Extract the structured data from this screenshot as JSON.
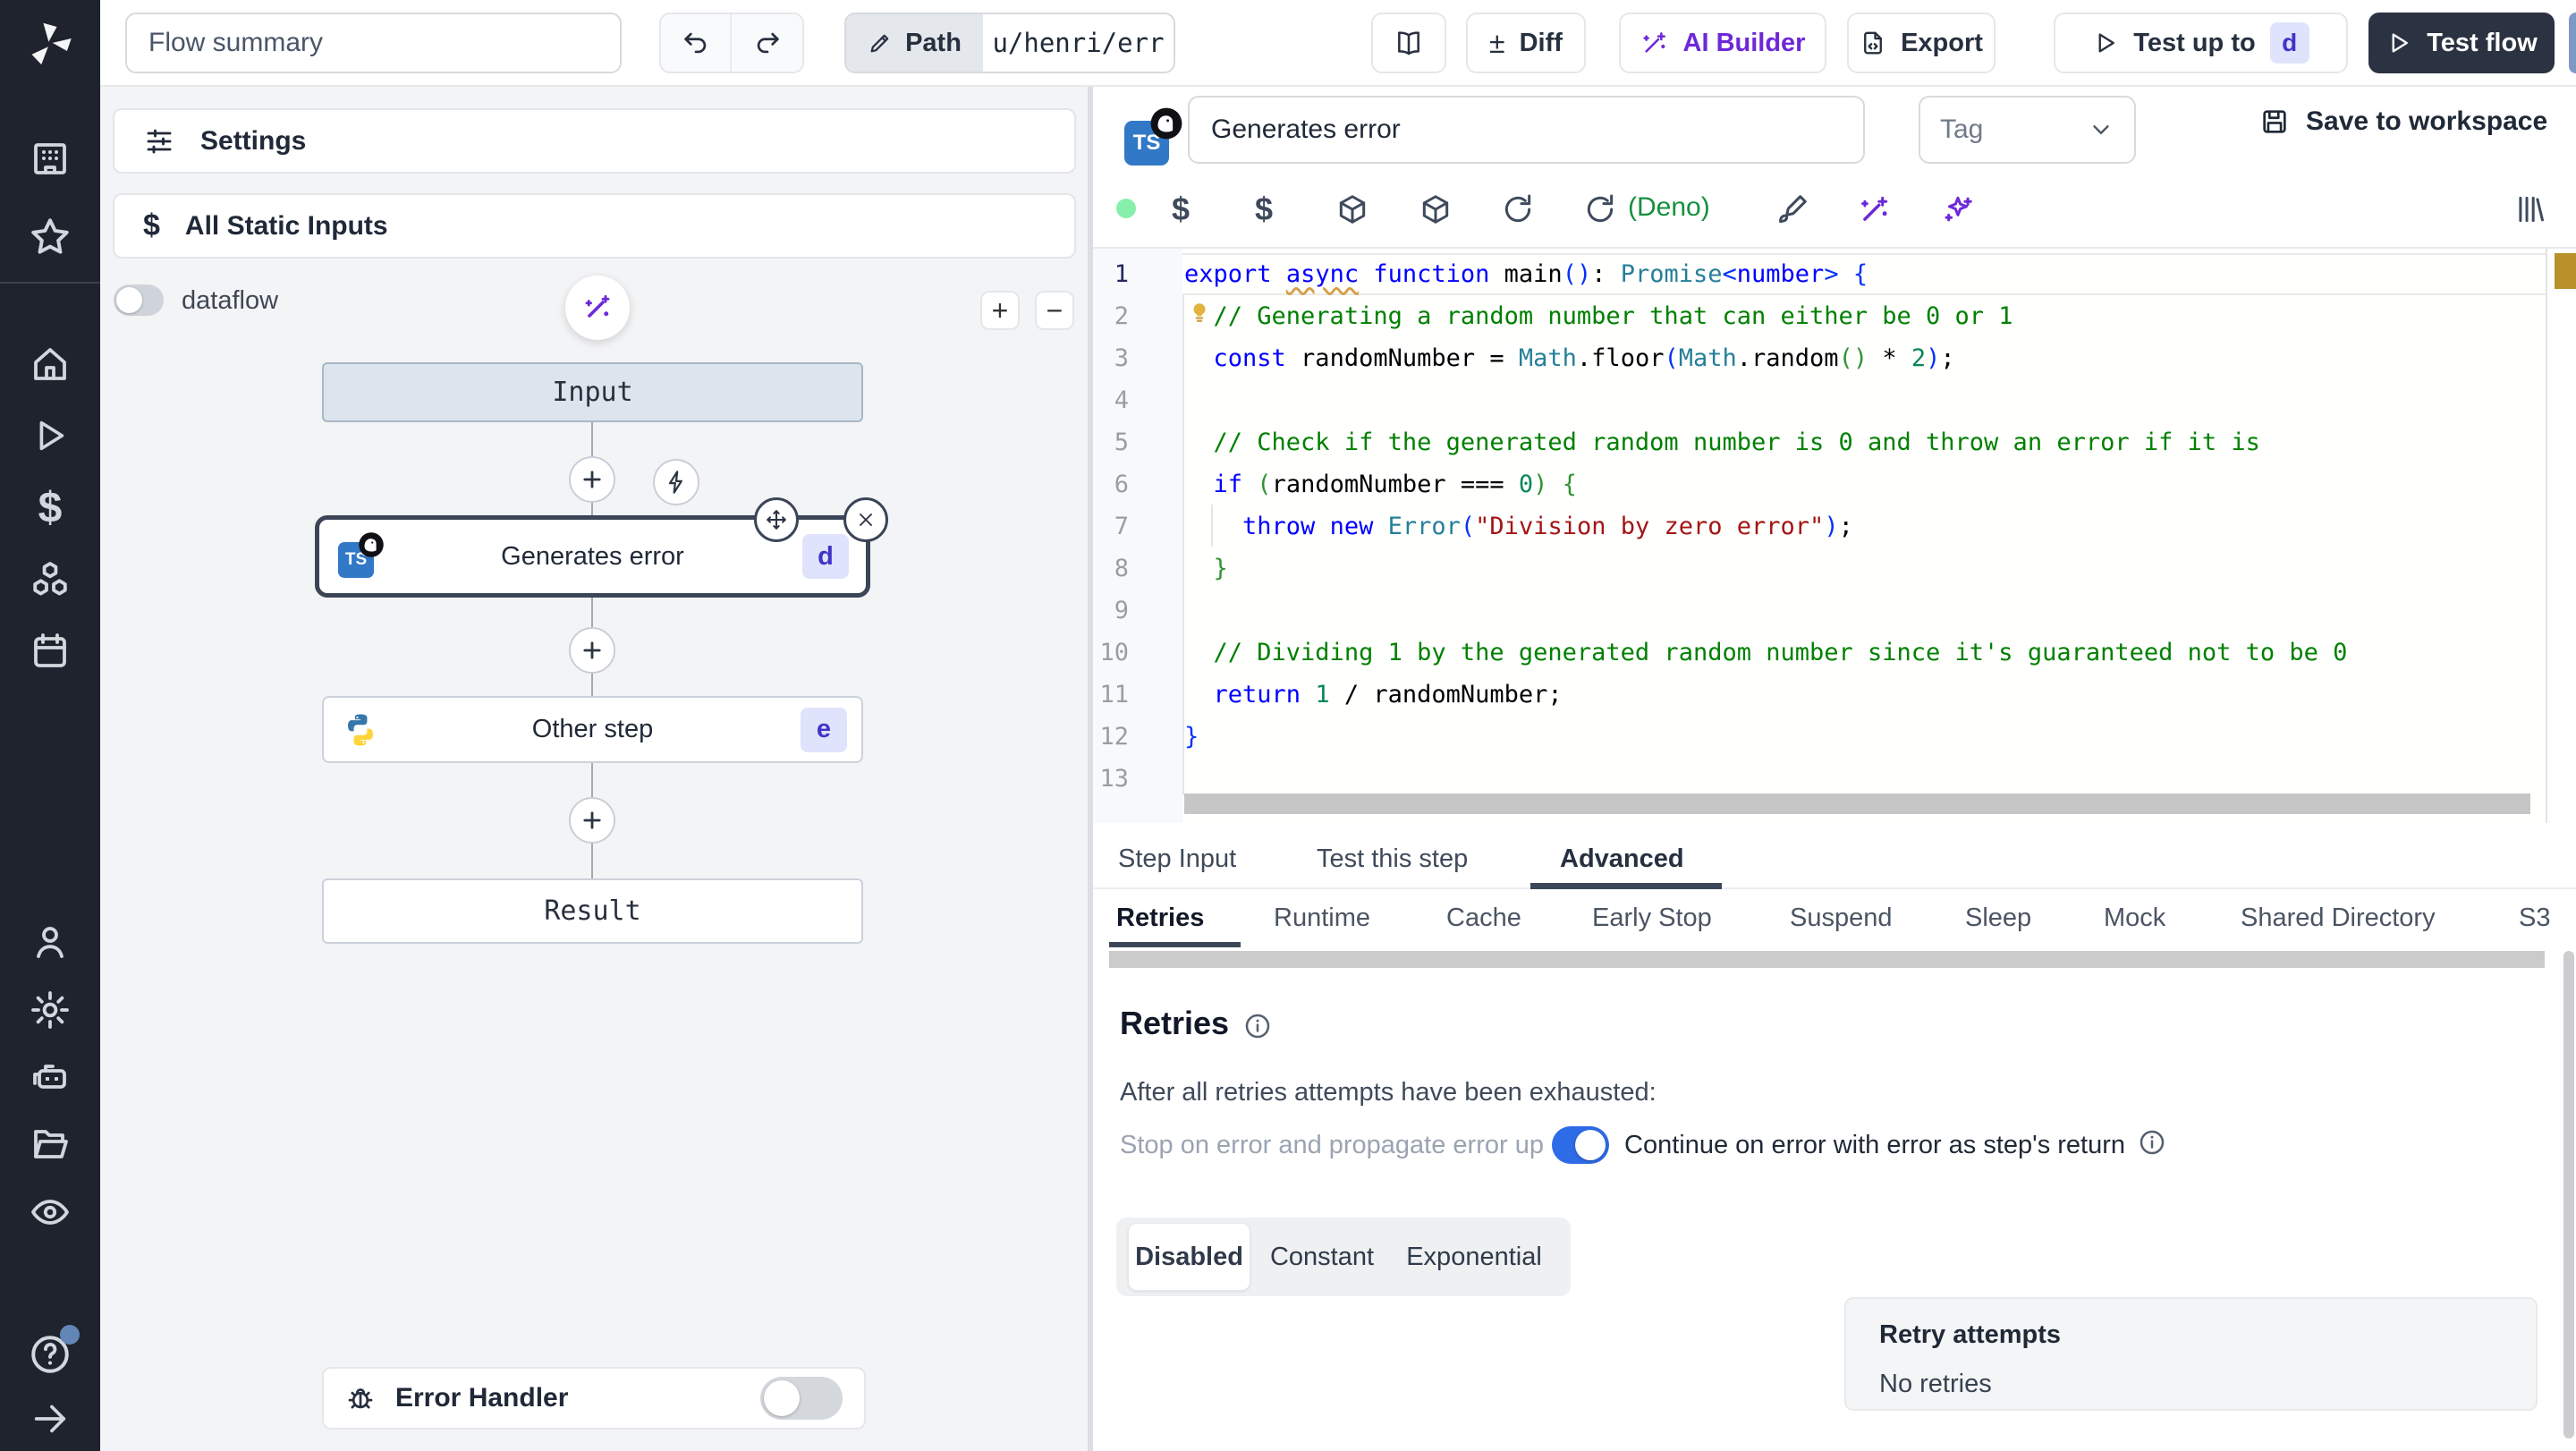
{
  "sidebar": {
    "icons": [
      "windmill-logo",
      "building",
      "star",
      "home",
      "play",
      "dollar",
      "cubes",
      "calendar",
      "user",
      "gear",
      "robot",
      "folder",
      "eye",
      "help",
      "collapse"
    ]
  },
  "topbar": {
    "flow_summary": "Flow summary",
    "path_label": "Path",
    "path_value": "u/henri/err",
    "diff": "Diff",
    "ai_builder": "AI Builder",
    "export": "Export",
    "test_up_to": "Test up to",
    "test_up_to_badge": "d",
    "test_flow": "Test flow"
  },
  "flow_panel": {
    "settings": "Settings",
    "all_static_inputs": "All Static Inputs",
    "dataflow": "dataflow",
    "zoom_in": "+",
    "zoom_out": "−",
    "nodes": {
      "input": "Input",
      "step_d": {
        "label": "Generates error",
        "badge": "d",
        "language": "typescript-deno"
      },
      "step_e": {
        "label": "Other step",
        "badge": "e",
        "language": "python"
      },
      "result": "Result"
    },
    "error_handler": "Error Handler"
  },
  "editor": {
    "step_name": "Generates error",
    "tag_placeholder": "Tag",
    "save_to_workspace": "Save to workspace",
    "language_badge": "TS",
    "deno_label": "(Deno)",
    "code": {
      "lines": [
        [
          [
            "k",
            "export"
          ],
          [
            "p",
            " "
          ],
          [
            "ku",
            "async"
          ],
          [
            "p",
            " "
          ],
          [
            "k",
            "function"
          ],
          [
            "p",
            " main"
          ],
          [
            "b1",
            "()"
          ],
          [
            "p",
            ": "
          ],
          [
            "t",
            "Promise"
          ],
          [
            "b1",
            "<"
          ],
          [
            "k",
            "number"
          ],
          [
            "b1",
            "> "
          ],
          [
            "b1",
            "{"
          ]
        ],
        [
          [
            "p",
            "  "
          ],
          [
            "c",
            "// Generating a random number that can either be 0 or 1"
          ]
        ],
        [
          [
            "p",
            "  "
          ],
          [
            "k",
            "const"
          ],
          [
            "p",
            " randomNumber = "
          ],
          [
            "t",
            "Math"
          ],
          [
            "p",
            ".floor"
          ],
          [
            "b1",
            "("
          ],
          [
            "t",
            "Math"
          ],
          [
            "p",
            ".random"
          ],
          [
            "b2",
            "()"
          ],
          [
            "p",
            " * "
          ],
          [
            "n",
            "2"
          ],
          [
            "b1",
            ")"
          ],
          [
            "p",
            ";"
          ]
        ],
        [],
        [
          [
            "p",
            "  "
          ],
          [
            "c",
            "// Check if the generated random number is 0 and throw an error if it is"
          ]
        ],
        [
          [
            "p",
            "  "
          ],
          [
            "k",
            "if"
          ],
          [
            "p",
            " "
          ],
          [
            "b2",
            "("
          ],
          [
            "p",
            "randomNumber === "
          ],
          [
            "n",
            "0"
          ],
          [
            "b2",
            ")"
          ],
          [
            "p",
            " "
          ],
          [
            "b2",
            "{"
          ]
        ],
        [
          [
            "p",
            "    "
          ],
          [
            "k",
            "throw"
          ],
          [
            "p",
            " "
          ],
          [
            "k",
            "new"
          ],
          [
            "p",
            " "
          ],
          [
            "t",
            "Error"
          ],
          [
            "b1",
            "("
          ],
          [
            "s",
            "\"Division by zero error\""
          ],
          [
            "b1",
            ")"
          ],
          [
            "p",
            ";"
          ]
        ],
        [
          [
            "p",
            "  "
          ],
          [
            "b2",
            "}"
          ]
        ],
        [],
        [
          [
            "p",
            "  "
          ],
          [
            "c",
            "// Dividing 1 by the generated random number since it's guaranteed not to be 0"
          ]
        ],
        [
          [
            "p",
            "  "
          ],
          [
            "k",
            "return"
          ],
          [
            "p",
            " "
          ],
          [
            "n",
            "1"
          ],
          [
            "p",
            " / randomNumber;"
          ]
        ],
        [
          [
            "b1",
            "}"
          ]
        ],
        []
      ]
    }
  },
  "tabs": {
    "items": [
      "Step Input",
      "Test this step",
      "Advanced"
    ],
    "active": "Advanced"
  },
  "subtabs": {
    "items": [
      "Retries",
      "Runtime",
      "Cache",
      "Early Stop",
      "Suspend",
      "Sleep",
      "Mock",
      "Shared Directory",
      "S3"
    ],
    "active": "Retries"
  },
  "retries": {
    "title": "Retries",
    "exhausted_label": "After all retries attempts have been exhausted:",
    "stop_option": "Stop on error and propagate error up",
    "continue_option": "Continue on error with error as step's return",
    "continue_enabled": true,
    "modes": [
      "Disabled",
      "Constant",
      "Exponential"
    ],
    "active_mode": "Disabled",
    "retry_attempts_label": "Retry attempts",
    "retry_attempts_value": "No retries"
  },
  "colors": {
    "accent_purple": "#6d28d9",
    "deno_green": "#15903f",
    "toggle_blue": "#2e6be6",
    "dark_button": "#2b3241",
    "badge_bg": "#dfe3fb",
    "badge_text": "#4035c8",
    "warning_marker": "#b8912b"
  }
}
